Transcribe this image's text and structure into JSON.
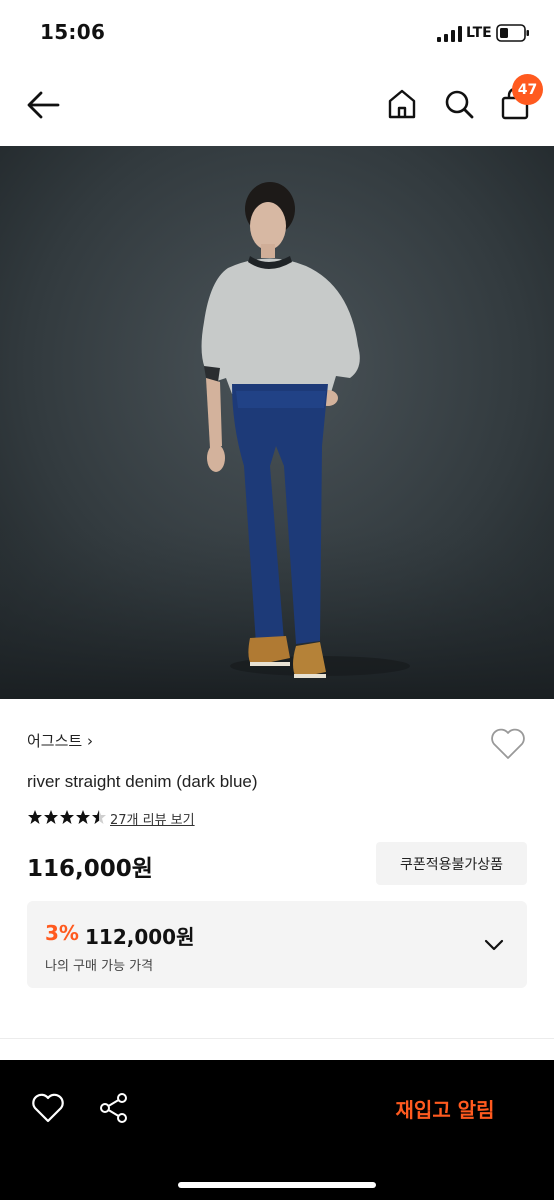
{
  "status_bar": {
    "time": "15:06",
    "network": "LTE",
    "icons": [
      "signal-icon",
      "battery-icon"
    ]
  },
  "nav": {
    "icons": [
      "back-arrow-icon",
      "home-icon",
      "search-icon",
      "shopping-bag-icon"
    ],
    "cart_badge": "47"
  },
  "product": {
    "brand": "어그스트 ›",
    "name": "river straight denim (dark blue)",
    "rating": 4.5,
    "review_link": "27개 리뷰 보기",
    "price": "116,000원",
    "coupon_notice": "쿠폰적용불가상품",
    "my_price": {
      "discount": "3%",
      "price": "112,000원",
      "label": "나의 구매 가능 가격"
    }
  },
  "bottom_bar": {
    "icons": [
      "heart-icon",
      "share-icon"
    ],
    "restock_label": "재입고 알림"
  },
  "colors": {
    "accent": "#ff5a1f",
    "bottom_bar": "#000000",
    "price_box": "#f4f4f4"
  }
}
